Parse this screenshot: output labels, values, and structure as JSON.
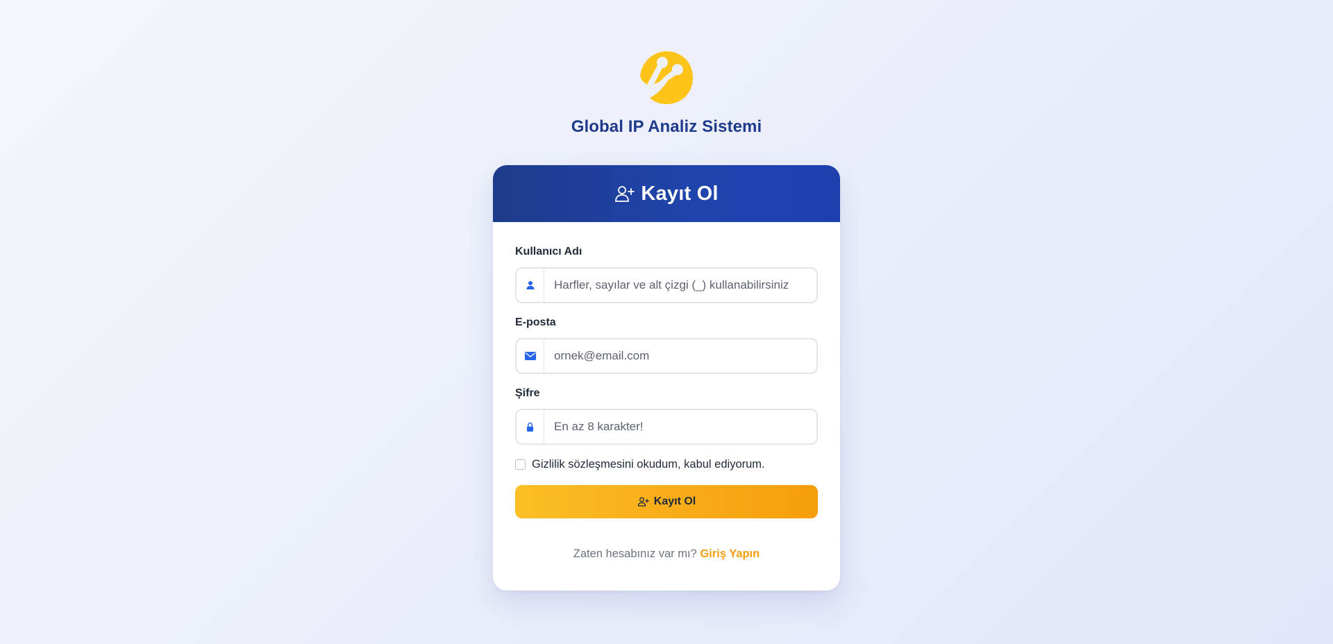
{
  "brand": {
    "title": "Global IP Analiz Sistemi",
    "logo_icon": "brand-logo-icon",
    "logo_color": "#fcc419"
  },
  "card": {
    "header_title": "Kayıt Ol",
    "header_icon": "user-plus-icon",
    "header_gradient": [
      "#1e3a8a",
      "#1e40af"
    ]
  },
  "form": {
    "username": {
      "label": "Kullanıcı Adı",
      "placeholder": "Harfler, sayılar ve alt çizgi (_) kullanabilirsiniz",
      "value": "",
      "icon": "user-icon"
    },
    "email": {
      "label": "E-posta",
      "placeholder": "ornek@email.com",
      "value": "",
      "icon": "envelope-icon"
    },
    "password": {
      "label": "Şifre",
      "placeholder": "En az 8 karakter!",
      "value": "",
      "icon": "lock-icon"
    },
    "privacy": {
      "label": "Gizlilik sözleşmesini okudum, kabul ediyorum.",
      "checked": false
    },
    "submit_label": "Kayıt Ol",
    "submit_icon": "user-plus-icon",
    "submit_colors": [
      "#fbbf24",
      "#f59e0b"
    ]
  },
  "footer": {
    "prompt": "Zaten hesabınız var mı?",
    "link_label": "Giriş Yapın",
    "link_color": "#f59e0b"
  },
  "colors": {
    "icon_accent": "#2563eb",
    "title": "#1e3a8a"
  }
}
